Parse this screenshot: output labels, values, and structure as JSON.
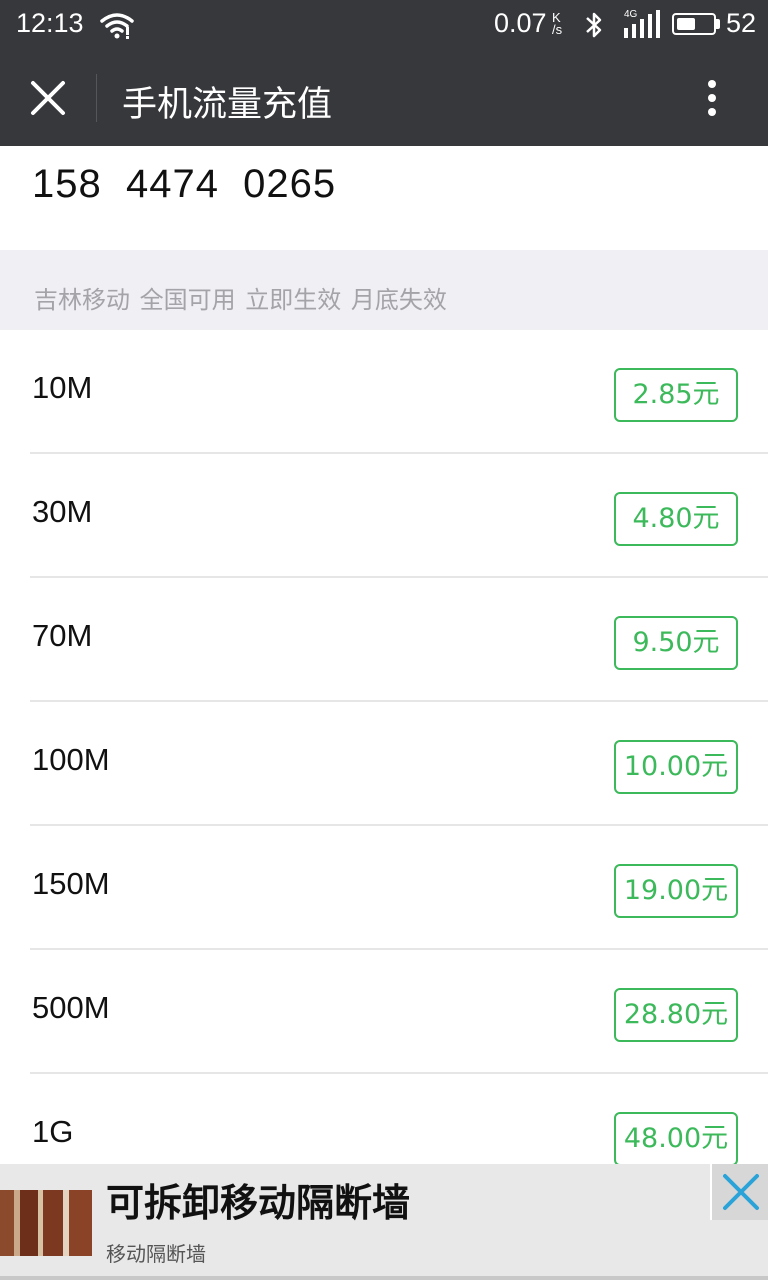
{
  "status_bar": {
    "time": "12:13",
    "net_speed": "0.07",
    "net_speed_unit_top": "K",
    "net_speed_unit_bottom": "/s",
    "network_type": "4G",
    "battery": "52",
    "battery_level": 0.52,
    "icons": [
      "wifi-icon",
      "bluetooth-icon",
      "signal-icon",
      "battery-icon"
    ]
  },
  "titlebar": {
    "title": "手机流量充值",
    "close_icon": "close-icon",
    "more_icon": "more-vertical-icon"
  },
  "phone": {
    "number": "158  4474  0265"
  },
  "carrier_info": "吉林移动 全国可用 立即生效 月底失效",
  "packages": [
    {
      "size": "10M",
      "price": "2.85元"
    },
    {
      "size": "30M",
      "price": "4.80元"
    },
    {
      "size": "70M",
      "price": "9.50元"
    },
    {
      "size": "100M",
      "price": "10.00元"
    },
    {
      "size": "150M",
      "price": "19.00元"
    },
    {
      "size": "500M",
      "price": "28.80元"
    },
    {
      "size": "1G",
      "price": "48.00元"
    }
  ],
  "ad": {
    "title": "可拆卸移动隔断墙",
    "subtitle": "移动隔断墙",
    "close_icon": "close-icon"
  },
  "colors": {
    "bar": "#37383c",
    "accent_green": "#3cb95a",
    "band": "#efeff4",
    "ad_close": "#2aa3d8"
  }
}
